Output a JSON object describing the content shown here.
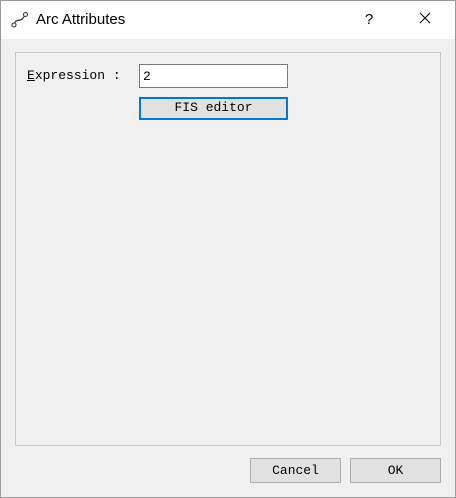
{
  "window": {
    "title": "Arc Attributes",
    "help_label": "?",
    "icons": {
      "app": "arc-graph-icon",
      "close": "close-icon"
    }
  },
  "form": {
    "expression_label_accel": "E",
    "expression_label_rest": "xpression :",
    "expression_value": "2",
    "fis_editor_label": "FIS editor"
  },
  "footer": {
    "cancel_label": "Cancel",
    "ok_label": "OK"
  },
  "colors": {
    "focus_accent": "#0078d7",
    "dialog_bg": "#f0f0f0",
    "button_bg": "#e1e1e1"
  }
}
